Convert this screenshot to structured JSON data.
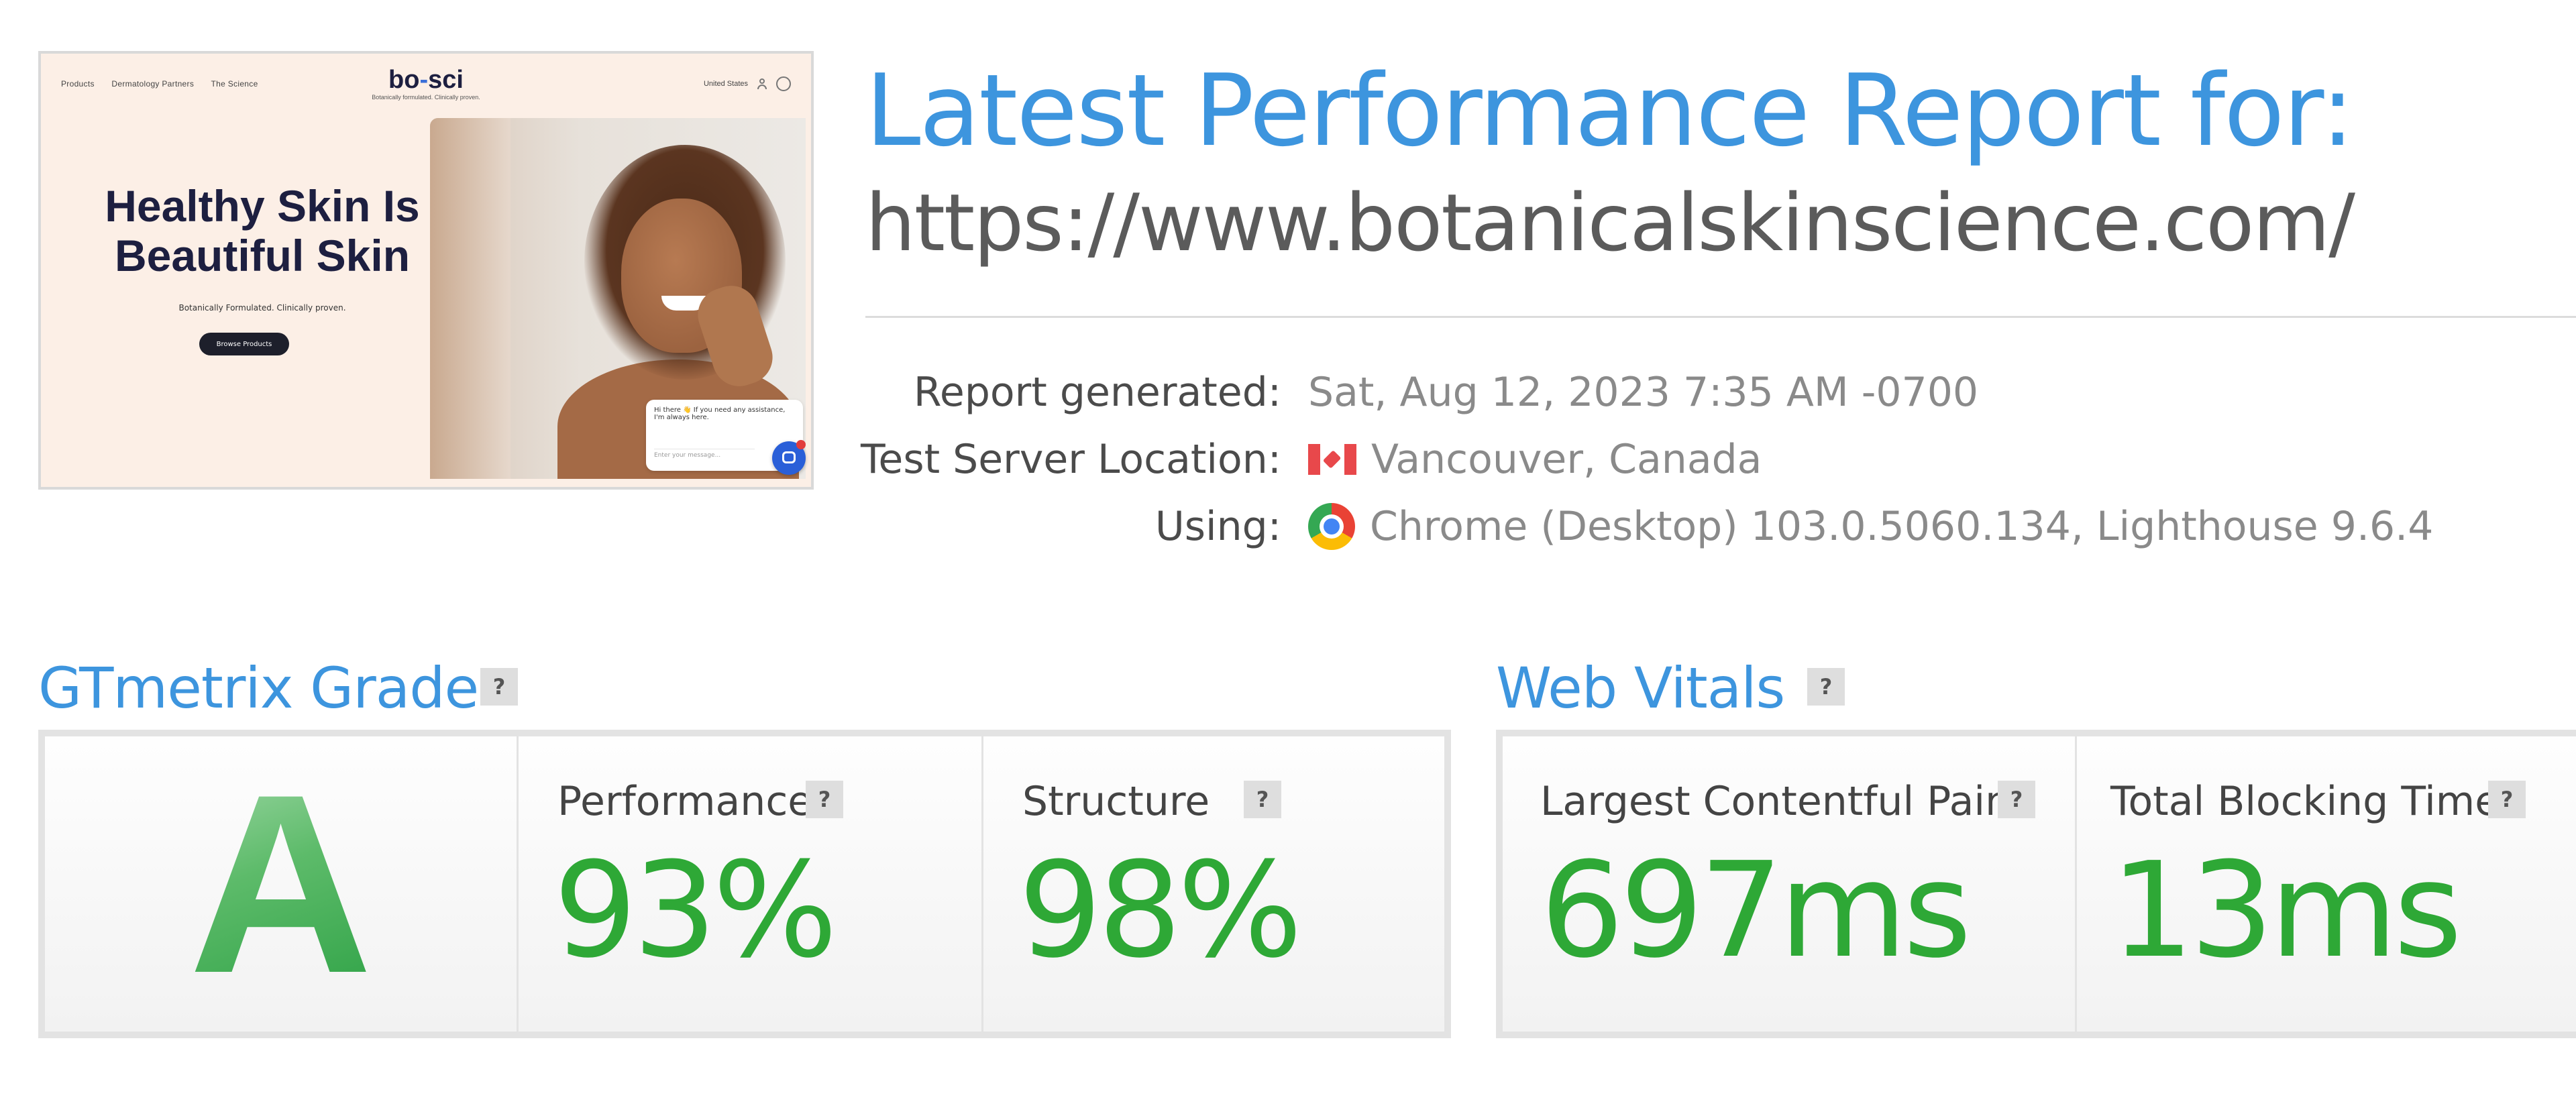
{
  "thumbnail": {
    "nav_left": [
      "Products",
      "Dermatology Partners",
      "The Science"
    ],
    "logo_left": "bo",
    "logo_dash": "-",
    "logo_right": "sci",
    "tagline": "Botanically formulated. Clinically proven.",
    "nav_right": "United States",
    "headline_line1": "Healthy Skin Is",
    "headline_line2": "Beautiful Skin",
    "subline": "Botanically Formulated. Clinically proven.",
    "button": "Browse Products",
    "chat_message": "Hi there 👋 If you need any assistance, I'm always here.",
    "chat_placeholder": "Enter your message..."
  },
  "header": {
    "title": "Latest Performance Report for:",
    "url": "https://www.botanicalskinscience.com/"
  },
  "meta": {
    "report_generated_label": "Report generated:",
    "report_generated_value": "Sat, Aug 12, 2023 7:35 AM -0700",
    "location_label": "Test Server Location:",
    "location_value": "Vancouver, Canada",
    "location_flag_icon": "canada-flag-icon",
    "using_label": "Using:",
    "using_value": "Chrome (Desktop) 103.0.5060.134, Lighthouse 9.6.4",
    "using_icon": "chrome-icon"
  },
  "grade": {
    "section_title": "GTmetrix Grade",
    "help": "?",
    "letter": "A",
    "performance_label": "Performance",
    "performance_value": "93%",
    "structure_label": "Structure",
    "structure_value": "98%"
  },
  "vitals": {
    "section_title": "Web Vitals",
    "help": "?",
    "lcp_label": "Largest Contentful Paint",
    "lcp_value": "697ms",
    "tbt_label": "Total Blocking Time",
    "tbt_value": "13ms"
  },
  "colors": {
    "accent_blue": "#3d95de",
    "value_green": "#2ea836",
    "text_gray": "#8a8a8a"
  }
}
